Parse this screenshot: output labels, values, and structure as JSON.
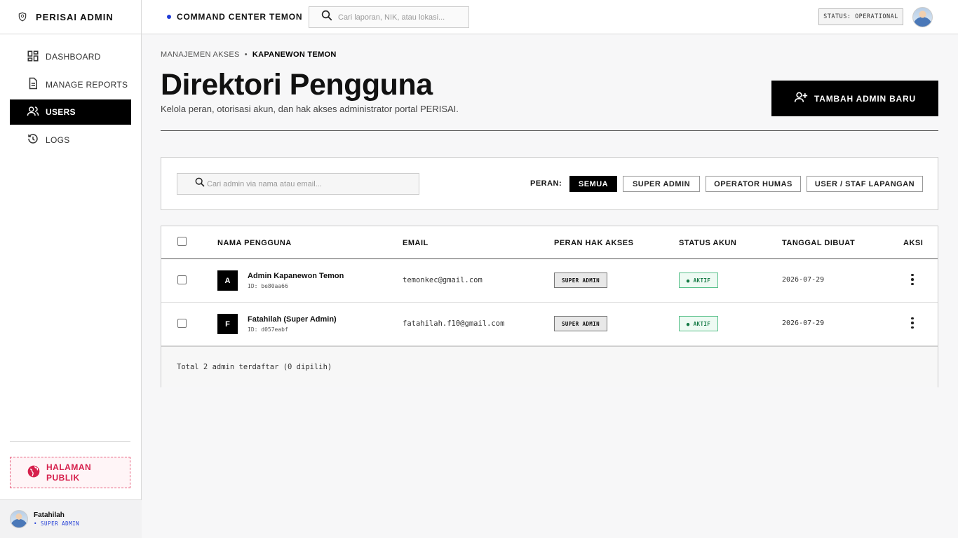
{
  "brand": {
    "title": "PERISAI ADMIN"
  },
  "sidebar": {
    "items": [
      {
        "label": "DASHBOARD",
        "icon": "dashboard-icon"
      },
      {
        "label": "MANAGE REPORTS",
        "icon": "document-icon"
      },
      {
        "label": "USERS",
        "icon": "users-icon",
        "active": true
      },
      {
        "label": "LOGS",
        "icon": "history-icon"
      }
    ],
    "public_button": {
      "line1": "HALAMAN",
      "line2": "PUBLIK"
    },
    "user": {
      "name": "Fatahilah",
      "role": "• SUPER ADMIN"
    }
  },
  "topbar": {
    "command_center": "COMMAND CENTER TEMON",
    "search_placeholder": "Cari laporan, NIK, atau lokasi...",
    "status": "STATUS: OPERATIONAL"
  },
  "page": {
    "breadcrumb": {
      "parent": "MANAJEMEN AKSES",
      "separator": "•",
      "current": "KAPANEWON TEMON"
    },
    "title": "Direktori Pengguna",
    "subtitle": "Kelola peran, otorisasi akun, dan hak akses administrator portal PERISAI.",
    "add_button": "TAMBAH ADMIN BARU"
  },
  "filter": {
    "search_placeholder": "Cari admin via nama atau email...",
    "role_label": "PERAN:",
    "chips": [
      "SEMUA",
      "SUPER ADMIN",
      "OPERATOR HUMAS",
      "USER / STAF LAPANGAN"
    ],
    "active_chip": "SEMUA"
  },
  "table": {
    "headers": {
      "name": "NAMA PENGGUNA",
      "email": "EMAIL",
      "role": "PERAN HAK AKSES",
      "status": "STATUS AKUN",
      "created": "TANGGAL DIBUAT",
      "action": "AKSI"
    },
    "rows": [
      {
        "initial": "A",
        "name": "Admin Kapanewon Temon",
        "id": "ID: be80aa66",
        "email": "temonkec@gmail.com",
        "role": "SUPER ADMIN",
        "status": "● AKTIF",
        "created": "2026-07-29"
      },
      {
        "initial": "F",
        "name": "Fatahilah (Super Admin)",
        "id": "ID: d057eabf",
        "email": "fatahilah.f10@gmail.com",
        "role": "SUPER ADMIN",
        "status": "● AKTIF",
        "created": "2026-07-29"
      }
    ],
    "footer": "Total 2 admin terdaftar (0 dipilih)"
  },
  "colors": {
    "accent_blue": "#1f3bd6",
    "public_red": "#d6204c",
    "status_green": "#157a45"
  }
}
